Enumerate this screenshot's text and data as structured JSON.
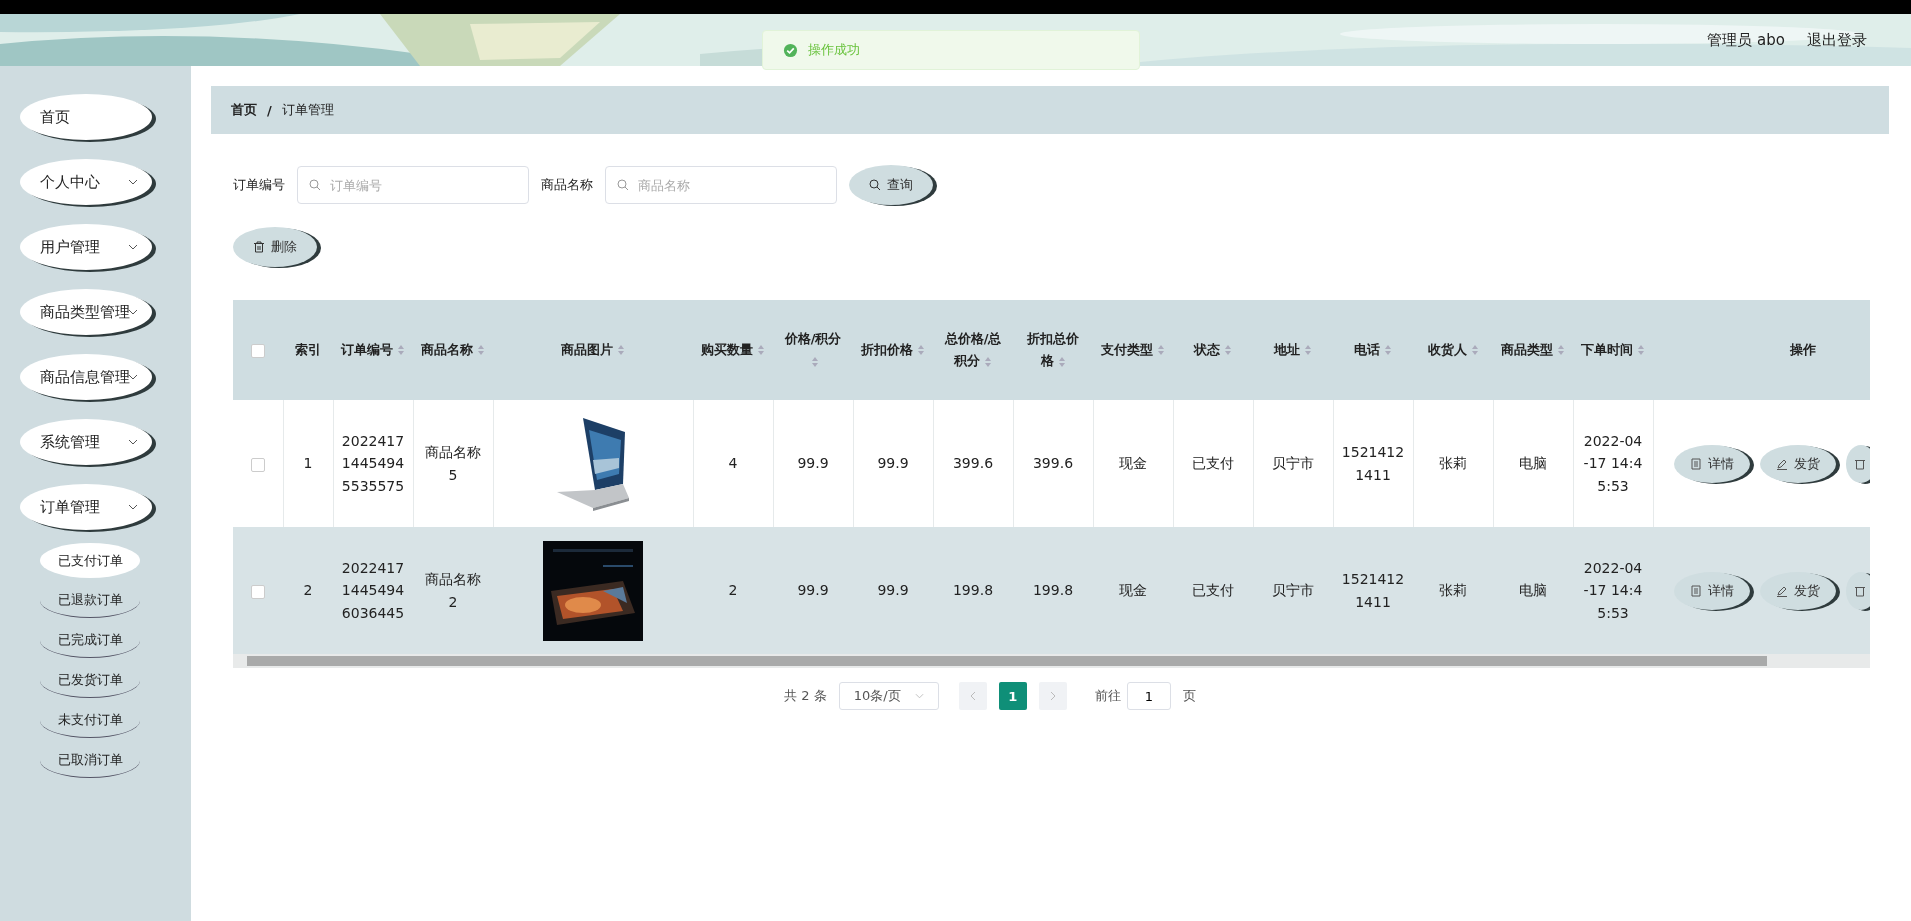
{
  "header": {
    "user": "管理员 abo",
    "logout": "退出登录"
  },
  "toast": {
    "text": "操作成功"
  },
  "sidebar": {
    "items": [
      {
        "label": "首页",
        "expandable": false
      },
      {
        "label": "个人中心",
        "expandable": true
      },
      {
        "label": "用户管理",
        "expandable": true
      },
      {
        "label": "商品类型管理",
        "expandable": true
      },
      {
        "label": "商品信息管理",
        "expandable": true
      },
      {
        "label": "系统管理",
        "expandable": true
      },
      {
        "label": "订单管理",
        "expandable": true,
        "children": [
          {
            "label": "已支付订单",
            "selected": true
          },
          {
            "label": "已退款订单",
            "selected": false
          },
          {
            "label": "已完成订单",
            "selected": false
          },
          {
            "label": "已发货订单",
            "selected": false
          },
          {
            "label": "未支付订单",
            "selected": false
          },
          {
            "label": "已取消订单",
            "selected": false
          }
        ]
      }
    ]
  },
  "breadcrumb": {
    "items": [
      "首页",
      "订单管理"
    ],
    "separator": "/"
  },
  "search": {
    "fields": [
      {
        "label": "订单编号",
        "placeholder": "订单编号"
      },
      {
        "label": "商品名称",
        "placeholder": "商品名称"
      }
    ],
    "button": "查询"
  },
  "delete_button": "删除",
  "table": {
    "select_all_checked": false,
    "columns": [
      {
        "label": "索引",
        "sortable": false,
        "kind": "narrow"
      },
      {
        "label": "订单编号",
        "sortable": true,
        "kind": "text"
      },
      {
        "label": "商品名称",
        "sortable": true,
        "kind": "text"
      },
      {
        "label": "商品图片",
        "sortable": true
      },
      {
        "label": "购买数量",
        "sortable": true,
        "kind": "text"
      },
      {
        "label": "价格/积分",
        "sortable": true,
        "kind": "text"
      },
      {
        "label": "折扣价格",
        "sortable": true,
        "kind": "text"
      },
      {
        "label": "总价格/总积分",
        "sortable": true,
        "kind": "text"
      },
      {
        "label": "折扣总价格",
        "sortable": true,
        "kind": "text"
      },
      {
        "label": "支付类型",
        "sortable": true,
        "kind": "text"
      },
      {
        "label": "状态",
        "sortable": true,
        "kind": "text"
      },
      {
        "label": "地址",
        "sortable": true,
        "kind": "text"
      },
      {
        "label": "电话",
        "sortable": true,
        "kind": "text"
      },
      {
        "label": "收货人",
        "sortable": true,
        "kind": "text"
      },
      {
        "label": "商品类型",
        "sortable": true,
        "kind": "text"
      },
      {
        "label": "下单时间",
        "sortable": true,
        "kind": "text"
      },
      {
        "label": "操作",
        "sortable": false,
        "kind": "actions"
      }
    ],
    "rows": [
      {
        "checked": false,
        "cells": [
          "1",
          "20224171445494 5535575",
          "商品名称5",
          {
            "kind": "picture"
          },
          "4",
          "99.9",
          "99.9",
          "399.6",
          "399.6",
          "现金",
          "已支付",
          "贝宁市",
          "15214121411",
          "张莉",
          "电脑",
          "2022-04-17 14:45:53"
        ],
        "actions": [
          "详情",
          "发货"
        ]
      },
      {
        "checked": false,
        "cells": [
          "2",
          "20224171445494 6036445",
          "商品名称2",
          {
            "kind": "picture"
          },
          "2",
          "99.9",
          "99.9",
          "199.8",
          "199.8",
          "现金",
          "已支付",
          "贝宁市",
          "15214121411",
          "张莉",
          "电脑",
          "2022-04-17 14:45:53"
        ],
        "actions": [
          "详情",
          "发货"
        ]
      }
    ]
  },
  "pagination": {
    "total": "共 2 条",
    "page_size": "10条/页",
    "pages": [
      {
        "label": "1",
        "selected": true
      }
    ],
    "goto_label": "前往",
    "goto_value": "1",
    "page_unit": "页"
  }
}
